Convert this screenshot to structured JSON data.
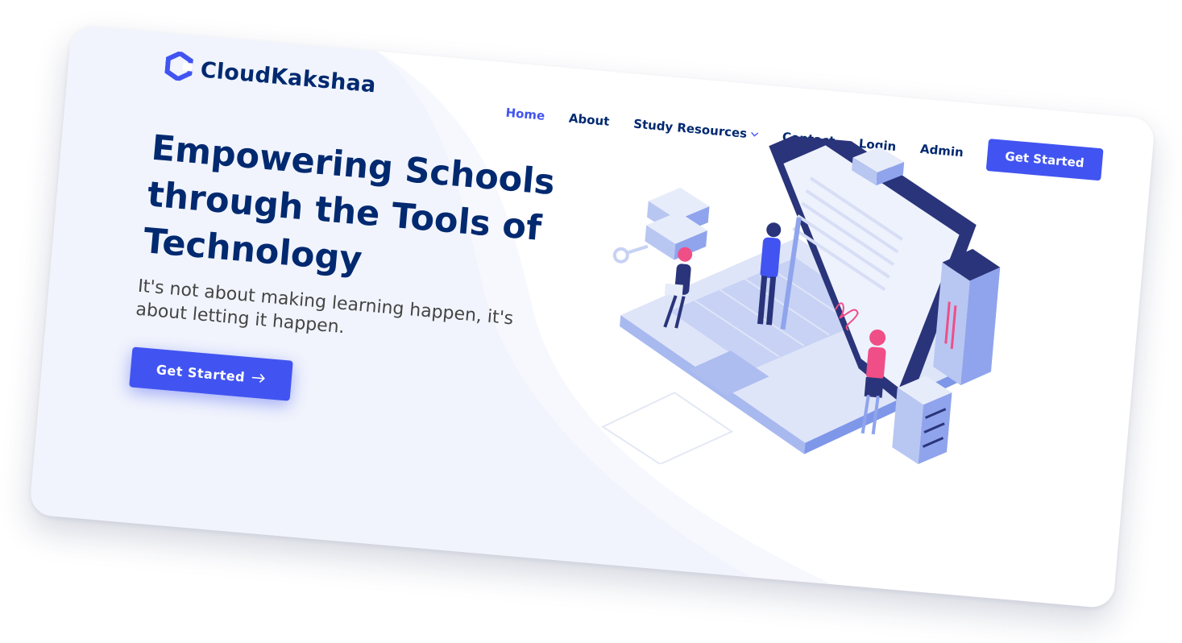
{
  "brand": {
    "name": "CloudKakshaa",
    "color_primary": "#4154f1",
    "color_dark": "#012970",
    "logo_icon": "hexagon-c-logo-icon"
  },
  "nav": {
    "items": [
      {
        "label": "Home",
        "active": true
      },
      {
        "label": "About"
      },
      {
        "label": "Study Resources",
        "has_dropdown": true
      },
      {
        "label": "Contact"
      },
      {
        "label": "Login"
      },
      {
        "label": "Admin"
      }
    ],
    "dropdown_icon": "chevron-down-icon",
    "cta_label": "Get Started"
  },
  "hero": {
    "title": "Empowering Schools through the Tools of Technology",
    "subtitle": "It's not about making learning happen, it's about letting it happen.",
    "cta_label": "Get Started",
    "cta_icon": "arrow-right-icon",
    "illustration": "isometric-laptop-people-servers-illustration"
  }
}
